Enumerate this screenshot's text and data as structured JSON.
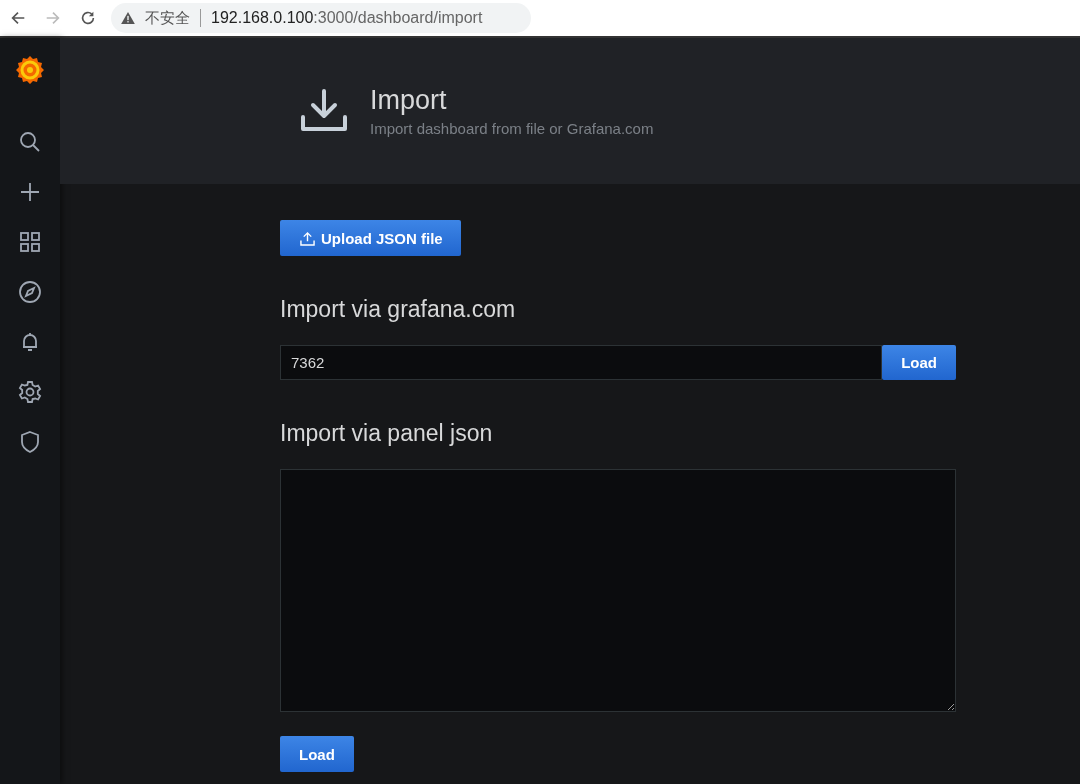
{
  "browser": {
    "security_label": "不安全",
    "url_host": "192.168.0.100",
    "url_path": ":3000/dashboard/import"
  },
  "page_header": {
    "title": "Import",
    "subtitle": "Import dashboard from file or Grafana.com"
  },
  "upload_button": "Upload JSON file",
  "grafana_section": {
    "heading": "Import via grafana.com",
    "field_value": "7362",
    "button": "Load"
  },
  "json_section": {
    "heading": "Import via panel json",
    "button": "Load"
  }
}
